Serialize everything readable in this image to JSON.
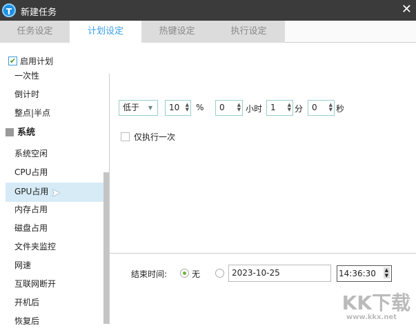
{
  "window": {
    "title": "新建任务",
    "logo": "T",
    "close": "✕"
  },
  "tabs": [
    "任务设定",
    "计划设定",
    "热键设定",
    "执行设定"
  ],
  "enable_plan": {
    "label": "启用计划",
    "checked": true
  },
  "sidebar": {
    "items": [
      "一次性",
      "倒计时",
      "整点|半点"
    ],
    "group": "系统",
    "group_items": [
      "系统空闲",
      "CPU占用",
      "GPU占用",
      "内存占用",
      "磁盘占用",
      "文件夹监控",
      "网速",
      "互联网断开",
      "开机后",
      "恢复后"
    ],
    "selected": "GPU占用"
  },
  "condition": {
    "compare": "低于",
    "percent": "10",
    "percent_unit": "%",
    "hours": "0",
    "hours_unit": "小时",
    "minutes": "1",
    "minutes_unit": "分",
    "seconds": "0",
    "seconds_unit": "秒"
  },
  "run_once": {
    "label": "仅执行一次",
    "checked": false
  },
  "end_time": {
    "label": "结束时间:",
    "none_label": "无",
    "none_selected": true,
    "date": "2023-10-25",
    "time": "14:36:30"
  },
  "watermark": {
    "text": "KK下载",
    "url": "www.kkx.net"
  }
}
